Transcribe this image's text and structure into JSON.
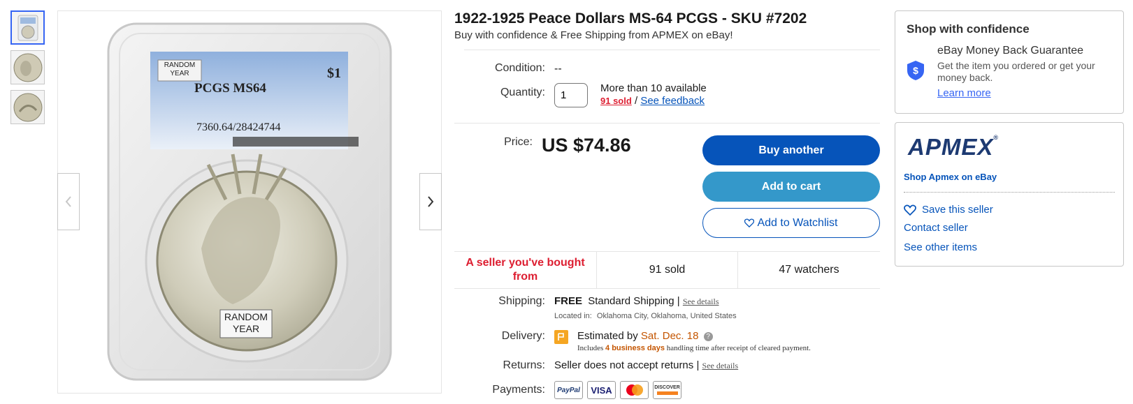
{
  "gallery": {
    "thumbnails": [
      "slab",
      "coin-obverse",
      "coin-reverse"
    ],
    "slab_label": {
      "random_year": "RANDOM YEAR",
      "grade": "PCGS MS64",
      "denomination": "$1",
      "cert": "7360.64/28424744"
    },
    "coin_overlay": "RANDOM YEAR"
  },
  "listing": {
    "title": "1922-1925 Peace Dollars MS-64 PCGS - SKU #7202",
    "subtitle": "Buy with confidence & Free Shipping from APMEX on eBay!",
    "condition_label": "Condition:",
    "condition_value": "--",
    "quantity_label": "Quantity:",
    "quantity_value": "1",
    "availability": "More than 10 available",
    "sold_link": "91 sold",
    "separator": "/",
    "feedback_link": "See feedback",
    "price_label": "Price:",
    "price": "US $74.86"
  },
  "actions": {
    "buy": "Buy another",
    "cart": "Add to cart",
    "watch": "Add to Watchlist"
  },
  "stats": {
    "seller_note": "A seller you've bought from",
    "sold": "91 sold",
    "watchers": "47 watchers"
  },
  "shipping": {
    "label": "Shipping:",
    "free": "FREE",
    "method": "Standard Shipping |",
    "details_link": "See details",
    "location_label": "Located in:",
    "location": "Oklahoma City, Oklahoma, United States"
  },
  "delivery": {
    "label": "Delivery:",
    "estimated_prefix": "Estimated by",
    "date": "Sat. Dec. 18",
    "includes": "Includes",
    "business_days": "4 business days",
    "handling": "handling time after receipt of cleared payment."
  },
  "returns": {
    "label": "Returns:",
    "value": "Seller does not accept returns |",
    "details_link": "See details"
  },
  "payments": {
    "label": "Payments:",
    "methods": [
      "PayPal",
      "VISA",
      "Mastercard",
      "DISCOVER"
    ]
  },
  "confidence": {
    "heading": "Shop with confidence",
    "guarantee_title": "eBay Money Back Guarantee",
    "guarantee_text": "Get the item you ordered or get your money back.",
    "learn_more": "Learn more"
  },
  "seller": {
    "logo": "APMEX",
    "shop_link": "Shop Apmex on eBay",
    "save": "Save this seller",
    "contact": "Contact seller",
    "other_items": "See other items"
  },
  "colors": {
    "primary_blue": "#0654ba",
    "button_blue": "#3498ca",
    "link_blue": "#3665f3",
    "alert_red": "#dd1e31",
    "delivery_orange": "#c45500",
    "apmex_navy": "#1d3a72"
  }
}
